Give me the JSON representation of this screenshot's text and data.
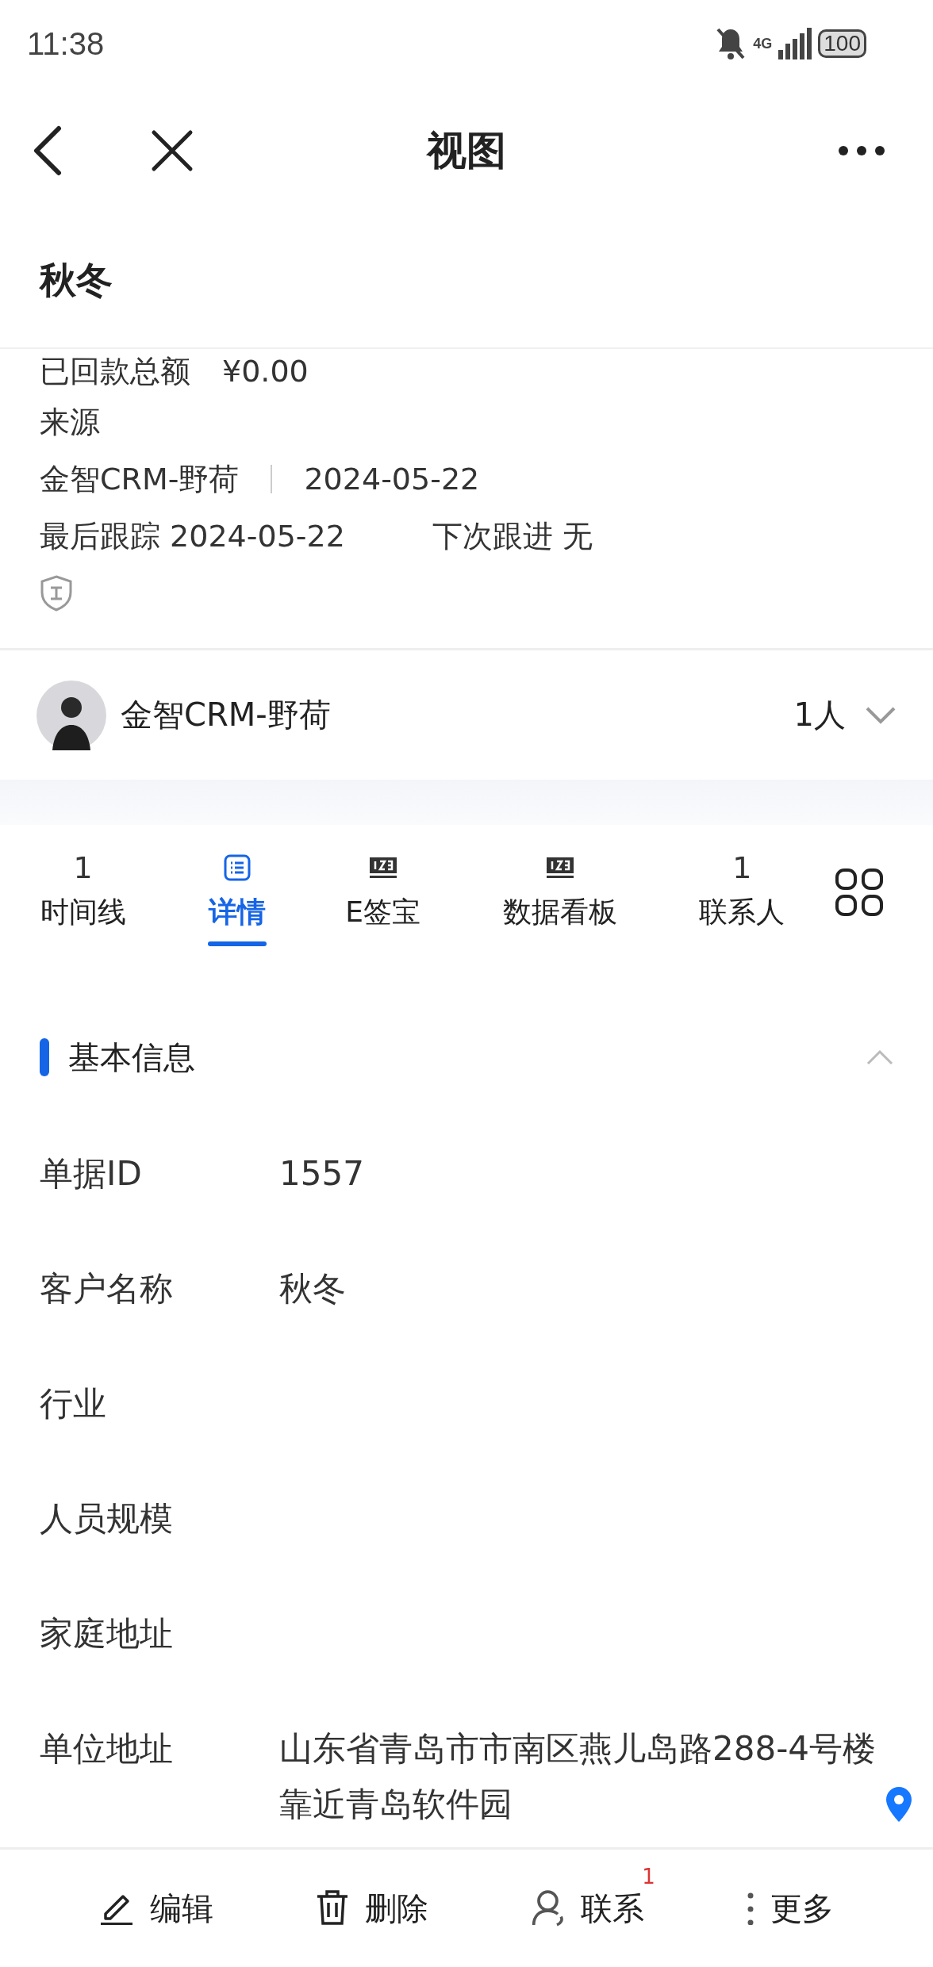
{
  "status_bar": {
    "time": "11:38",
    "network": "4G",
    "battery": "100"
  },
  "nav": {
    "title": "视图"
  },
  "record": {
    "title": "秋冬",
    "summary": {
      "paid_label": "已回款总额",
      "paid_value": "¥0.00",
      "source_label": "来源",
      "source_owner": "金智CRM-野荷",
      "source_date": "2024-05-22",
      "last_follow": "最后跟踪 2024-05-22",
      "next_follow": "下次跟进 无"
    }
  },
  "owner": {
    "name": "金智CRM-野荷",
    "count": "1人",
    "expanded": false
  },
  "tabs": [
    {
      "kind": "count",
      "badge": "1",
      "label": "时间线",
      "selected": false
    },
    {
      "kind": "list",
      "label": "详情",
      "selected": true
    },
    {
      "kind": "board",
      "label": "E签宝",
      "selected": false
    },
    {
      "kind": "board",
      "label": "数据看板",
      "selected": false
    },
    {
      "kind": "count",
      "badge": "1",
      "label": "联系人",
      "selected": false
    }
  ],
  "section": {
    "title": "基本信息",
    "expanded": true,
    "fields": [
      {
        "label": "单据ID",
        "value": "1557"
      },
      {
        "label": "客户名称",
        "value": "秋冬"
      },
      {
        "label": "行业"
      },
      {
        "label": "人员规模"
      },
      {
        "label": "家庭地址"
      },
      {
        "label": "单位地址",
        "value": "山东省青岛市市南区燕儿岛路288-4号楼靠近青岛软件园",
        "location": true
      }
    ]
  },
  "actions": [
    {
      "kind": "edit",
      "label": "编辑"
    },
    {
      "kind": "delete",
      "label": "删除"
    },
    {
      "kind": "contact",
      "label": "联系",
      "badge": "1"
    },
    {
      "kind": "more",
      "label": "更多"
    }
  ]
}
